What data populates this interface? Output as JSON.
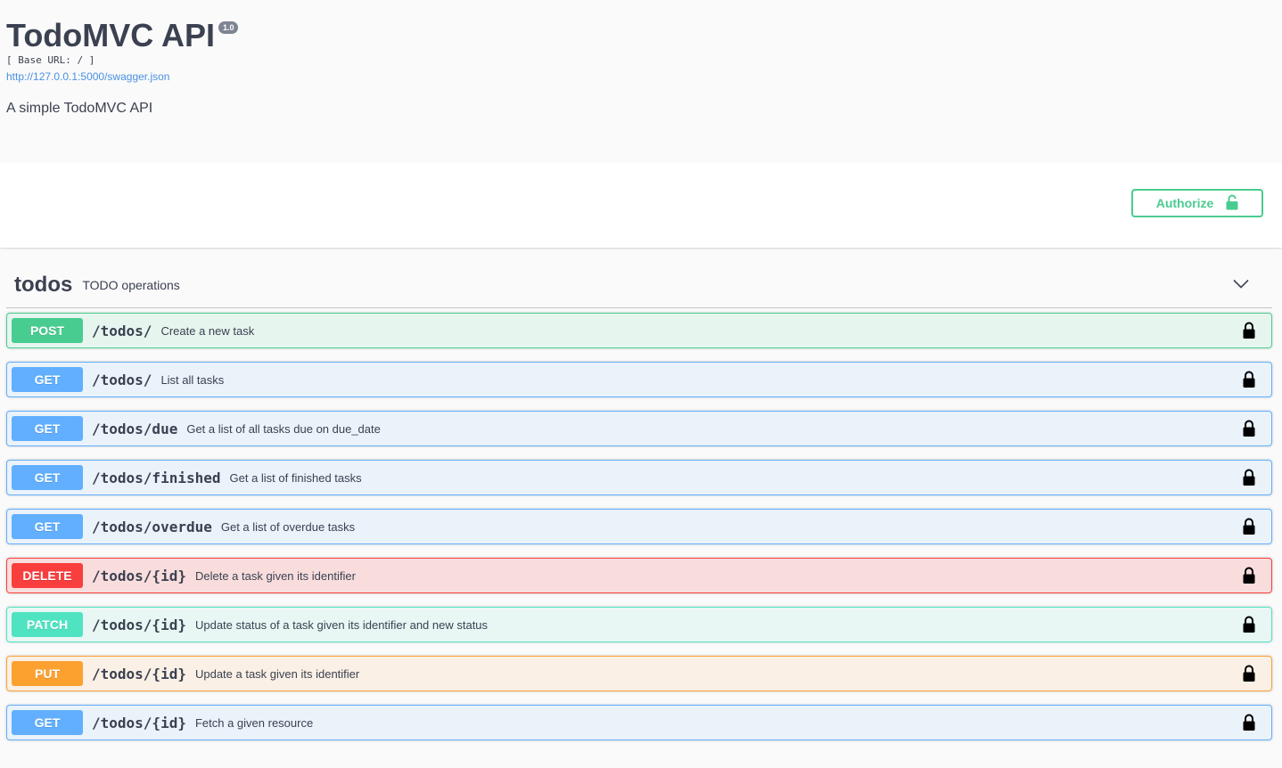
{
  "info": {
    "title": "TodoMVC API",
    "version": "1.0",
    "base_url": "[ Base URL: / ]",
    "spec_link": "http://127.0.0.1:5000/swagger.json",
    "description": "A simple TodoMVC API"
  },
  "auth": {
    "label": "Authorize"
  },
  "tag": {
    "name": "todos",
    "description": "TODO operations"
  },
  "colors": {
    "post": "#49cc90",
    "get": "#61affe",
    "delete": "#f93e3e",
    "patch": "#50e3c2",
    "put": "#fca130"
  },
  "operations": [
    {
      "method": "POST",
      "path": "/todos/",
      "summary": "Create a new task"
    },
    {
      "method": "GET",
      "path": "/todos/",
      "summary": "List all tasks"
    },
    {
      "method": "GET",
      "path": "/todos/due",
      "summary": "Get a list of all tasks due on due_date"
    },
    {
      "method": "GET",
      "path": "/todos/finished",
      "summary": "Get a list of finished tasks"
    },
    {
      "method": "GET",
      "path": "/todos/overdue",
      "summary": "Get a list of overdue tasks"
    },
    {
      "method": "DELETE",
      "path": "/todos/{id}",
      "summary": "Delete a task given its identifier"
    },
    {
      "method": "PATCH",
      "path": "/todos/{id}",
      "summary": "Update status of a task given its identifier and new status"
    },
    {
      "method": "PUT",
      "path": "/todos/{id}",
      "summary": "Update a task given its identifier"
    },
    {
      "method": "GET",
      "path": "/todos/{id}",
      "summary": "Fetch a given resource"
    }
  ]
}
